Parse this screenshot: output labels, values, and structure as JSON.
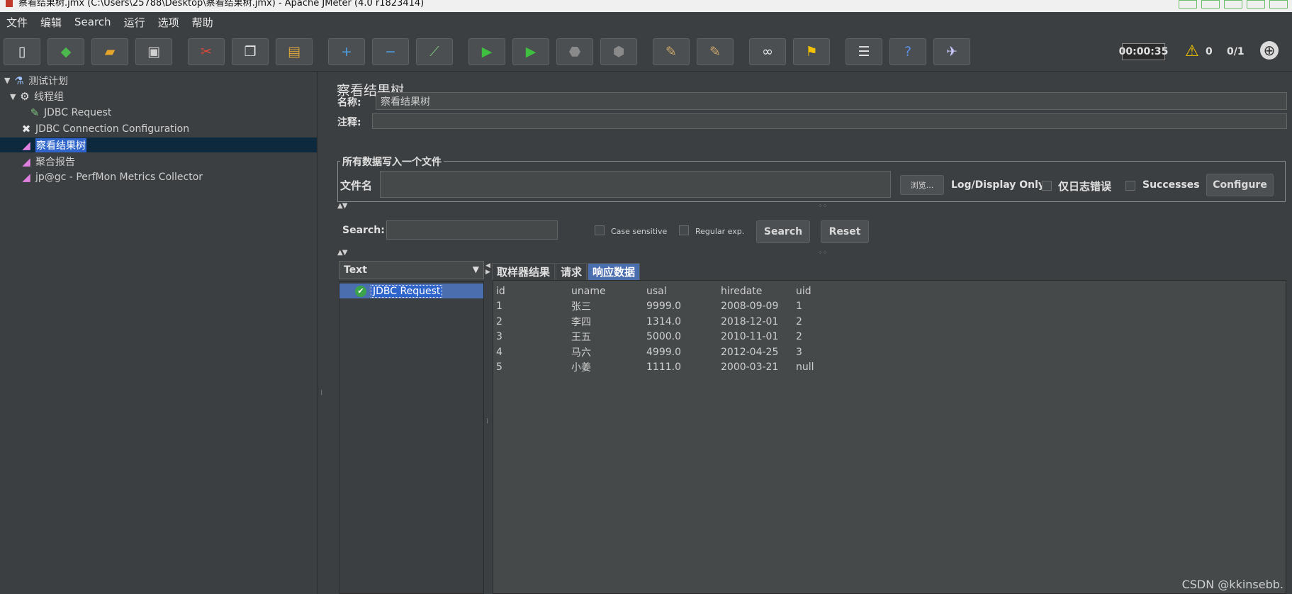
{
  "window": {
    "title": "察看结果树.jmx (C:\\Users\\25788\\Desktop\\察看结果树.jmx) - Apache JMeter (4.0 r1823414)"
  },
  "menu": [
    "文件",
    "编辑",
    "Search",
    "运行",
    "选项",
    "帮助"
  ],
  "toolbar": {
    "buttons": [
      {
        "name": "new-icon",
        "glyph": "▯",
        "color": "#f4f4f4"
      },
      {
        "name": "templates-icon",
        "glyph": "◆",
        "color": "#4db84d"
      },
      {
        "name": "open-icon",
        "glyph": "▰",
        "color": "#e5a52b"
      },
      {
        "name": "save-icon",
        "glyph": "▣",
        "color": "#d0d0d0"
      },
      {
        "name": "cut-icon",
        "glyph": "✂",
        "color": "#e04a3a"
      },
      {
        "name": "copy-icon",
        "glyph": "❐",
        "color": "#e6e6e6"
      },
      {
        "name": "paste-icon",
        "glyph": "▤",
        "color": "#d9a23a"
      },
      {
        "name": "expand-icon",
        "glyph": "+",
        "color": "#4ea0e6"
      },
      {
        "name": "collapse-icon",
        "glyph": "−",
        "color": "#4ea0e6"
      },
      {
        "name": "toggle-icon",
        "glyph": "⟋",
        "color": "#7fc77f"
      },
      {
        "name": "start-icon",
        "glyph": "▶",
        "color": "#3fbf3f"
      },
      {
        "name": "start-no-pauses-icon",
        "glyph": "▶",
        "color": "#3fbf3f"
      },
      {
        "name": "stop-icon",
        "glyph": "⬣",
        "color": "#8a8a8a"
      },
      {
        "name": "shutdown-icon",
        "glyph": "⬢",
        "color": "#8a8a8a"
      },
      {
        "name": "clear-icon",
        "glyph": "✎",
        "color": "#c9a46a"
      },
      {
        "name": "clear-all-icon",
        "glyph": "✎",
        "color": "#c9a46a"
      },
      {
        "name": "search-binoculars-icon",
        "glyph": "∞",
        "color": "#e6e6e6"
      },
      {
        "name": "reset-search-broom-icon",
        "glyph": "⚑",
        "color": "#f2c200"
      },
      {
        "name": "function-helper-icon",
        "glyph": "☰",
        "color": "#e6e6e6"
      },
      {
        "name": "help-icon",
        "glyph": "?",
        "color": "#5b8fe6"
      },
      {
        "name": "remote-start-icon",
        "glyph": "✈",
        "color": "#c9c9ff"
      }
    ],
    "timer": "00:00:35",
    "warning_count": "0",
    "threads": "0/1"
  },
  "tree": [
    {
      "label": "测试计划",
      "level": 0,
      "toggle": "▼",
      "icon": "flask-icon",
      "glyph": "⚗",
      "color": "#9fc3ff",
      "selected": false
    },
    {
      "label": "线程组",
      "level": 1,
      "toggle": "▼",
      "icon": "gear-icon",
      "glyph": "⚙",
      "color": "#e6e6e6",
      "selected": false
    },
    {
      "label": "JDBC Request",
      "level": 2,
      "toggle": "",
      "icon": "pipette-icon",
      "glyph": "✎",
      "color": "#7fc77f",
      "selected": false
    },
    {
      "label": "JDBC Connection Configuration",
      "level": 1,
      "toggle": "",
      "icon": "wrench-icon",
      "glyph": "✖",
      "color": "#e6e6e6",
      "selected": false
    },
    {
      "label": "察看结果树",
      "level": 1,
      "toggle": "",
      "icon": "listener-graph-icon",
      "glyph": "◢",
      "color": "#e080e0",
      "selected": true
    },
    {
      "label": "聚合报告",
      "level": 1,
      "toggle": "",
      "icon": "listener-graph-icon",
      "glyph": "◢",
      "color": "#e080e0",
      "selected": false
    },
    {
      "label": "jp@gc - PerfMon Metrics Collector",
      "level": 1,
      "toggle": "",
      "icon": "listener-graph-icon",
      "glyph": "◢",
      "color": "#e080e0",
      "selected": false
    }
  ],
  "panel": {
    "title": "察看结果树",
    "name_label": "名称:",
    "name_value": "察看结果树",
    "comment_label": "注释:",
    "comment_value": "",
    "file_section_title": "所有数据写入一个文件",
    "filename_label": "文件名",
    "filename_value": "",
    "browse_label": "浏览...",
    "log_display_label": "Log/Display Only:",
    "errors_only_label": "仅日志错误",
    "successes_label": "Successes",
    "configure_label": "Configure"
  },
  "search": {
    "label": "Search:",
    "value": "",
    "case_sensitive_label": "Case sensitive",
    "regex_label": "Regular exp.",
    "search_button": "Search",
    "reset_button": "Reset"
  },
  "renderer": {
    "selected": "Text"
  },
  "results": [
    {
      "label": "JDBC Request",
      "status": "success"
    }
  ],
  "tabs": [
    {
      "label": "取样器结果",
      "active": false
    },
    {
      "label": "请求",
      "active": false
    },
    {
      "label": "响应数据",
      "active": true
    }
  ],
  "response_table": {
    "headers": [
      "id",
      "uname",
      "usal",
      "hiredate",
      "uid"
    ],
    "rows": [
      [
        "1",
        "张三",
        "9999.0",
        "2008-09-09",
        "1"
      ],
      [
        "2",
        "李四",
        "1314.0",
        "2018-12-01",
        "2"
      ],
      [
        "3",
        "王五",
        "5000.0",
        "2010-11-01",
        "2"
      ],
      [
        "4",
        "马六",
        "4999.0",
        "2012-04-25",
        "3"
      ],
      [
        "5",
        "小姜",
        "1111.0",
        "2000-03-21",
        "null"
      ]
    ]
  },
  "watermark": "CSDN @kkinsebb."
}
